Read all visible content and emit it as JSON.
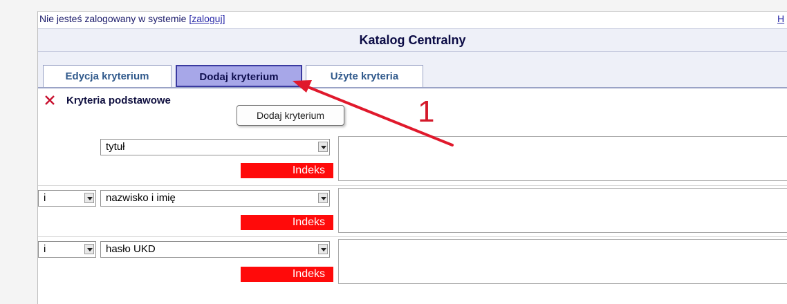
{
  "header": {
    "login_prefix": "Nie jesteś zalogowany w systemie ",
    "login_link": "[zaloguj]",
    "help_link": "H",
    "title": "Katalog Centralny"
  },
  "tabs": [
    {
      "label": "Edycja kryterium"
    },
    {
      "label": "Dodaj kryterium"
    },
    {
      "label": "Użyte kryteria"
    }
  ],
  "section": {
    "label": "Kryteria podstawowe"
  },
  "tooltip": {
    "text": "Dodaj kryterium"
  },
  "annotation": {
    "number": "1",
    "color": "#d4192a"
  },
  "criteria": [
    {
      "operator": "",
      "field": "tytuł",
      "index_label": "Indeks",
      "value": ""
    },
    {
      "operator": "i",
      "field": "nazwisko i imię",
      "index_label": "Indeks",
      "value": ""
    },
    {
      "operator": "i",
      "field": "hasło UKD",
      "index_label": "Indeks",
      "value": ""
    }
  ],
  "colors": {
    "index_button": "#ff0a0a",
    "active_tab": "#a7a7e8",
    "tab_text": "#315a8c"
  }
}
